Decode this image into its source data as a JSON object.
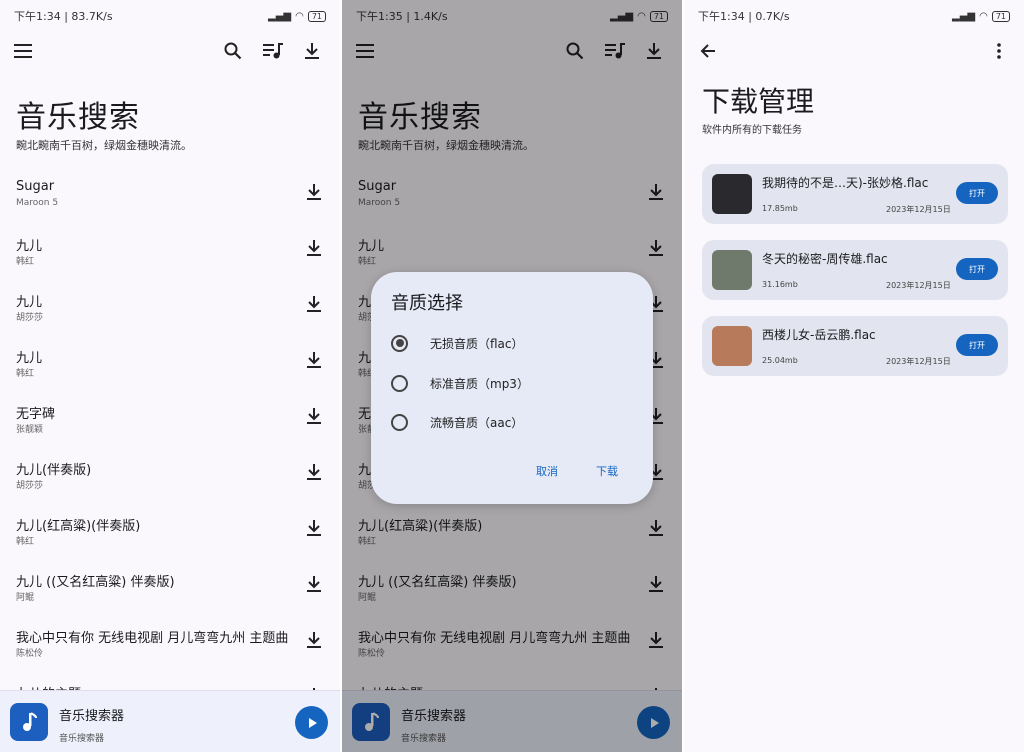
{
  "screen1": {
    "status": {
      "time": "下午1:34",
      "net": "83.7K/s",
      "battery": "71"
    },
    "title": "音乐搜索",
    "subtitle": "畹北畹南千百树，绿烟金穗映清流。",
    "songs": [
      {
        "title": "Sugar",
        "artist": "Maroon 5"
      },
      {
        "title": "九儿",
        "artist": "韩红"
      },
      {
        "title": "九儿",
        "artist": "胡莎莎"
      },
      {
        "title": "九儿",
        "artist": "韩红"
      },
      {
        "title": "无字碑",
        "artist": "张靓颖"
      },
      {
        "title": "九儿(伴奏版)",
        "artist": "胡莎莎"
      },
      {
        "title": "九儿(红高粱)(伴奏版)",
        "artist": "韩红"
      },
      {
        "title": "九儿 ((又名红高粱) 伴奏版)",
        "artist": "阿鲲"
      },
      {
        "title": "我心中只有你 无线电视剧 月儿弯弯九州 主题曲",
        "artist": "陈松伶"
      },
      {
        "title": "九儿的主题",
        "artist": ""
      }
    ],
    "player": {
      "title": "音乐搜索器",
      "subtitle": "音乐搜索器"
    }
  },
  "screen2": {
    "status": {
      "time": "下午1:35",
      "net": "1.4K/s",
      "battery": "71"
    },
    "dialog": {
      "title": "音质选择",
      "options": [
        "无损音质（flac）",
        "标准音质（mp3）",
        "流畅音质（aac）"
      ],
      "selected_index": 0,
      "cancel": "取消",
      "confirm": "下载"
    }
  },
  "screen3": {
    "status": {
      "time": "下午1:34",
      "net": "0.7K/s",
      "battery": "71"
    },
    "title": "下载管理",
    "subtitle": "软件内所有的下载任务",
    "downloads": [
      {
        "name": "我期待的不是…天)-张妙格.flac",
        "size": "17.85mb",
        "date": "2023年12月15日",
        "action": "打开",
        "cover_color": "#2a2a2e"
      },
      {
        "name": "冬天的秘密-周传雄.flac",
        "size": "31.16mb",
        "date": "2023年12月15日",
        "action": "打开",
        "cover_color": "#6f7a6d"
      },
      {
        "name": "西楼儿女-岳云鹏.flac",
        "size": "25.04mb",
        "date": "2023年12月15日",
        "action": "打开",
        "cover_color": "#b77a5a"
      }
    ]
  },
  "icons": [
    "menu-icon",
    "search-icon",
    "queue-music-icon",
    "download-icon",
    "music-note-icon",
    "play-icon",
    "back-arrow-icon",
    "more-vert-icon"
  ],
  "colors": {
    "accent": "#1565c0",
    "background": "#fbf8fd",
    "dialog": "#e6eaf6",
    "card": "#e2e5ef"
  }
}
